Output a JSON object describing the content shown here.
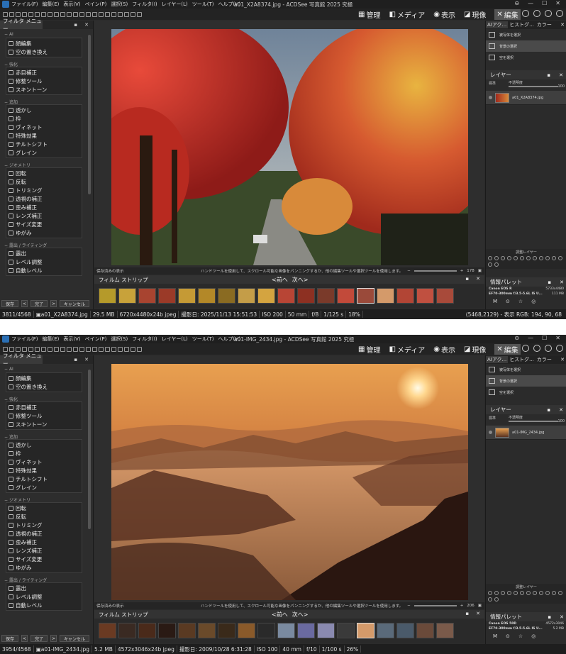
{
  "windows": [
    {
      "title": "a01_X2A8374.jpg - ACDSee 写真館 2025 究極",
      "menu": [
        "ファイル(F)",
        "編集(E)",
        "表示(V)",
        "ペイン(P)",
        "選択(S)",
        "フィルタ(I)",
        "レイヤー(L)",
        "ツール(T)",
        "ヘルプ(H)"
      ],
      "modes": [
        "管理",
        "メディア",
        "表示",
        "現像",
        "編集"
      ],
      "left_panel": {
        "tab": "フィルタ メニュー",
        "groups": [
          {
            "head": "AI",
            "items": [
              "顔編集",
              "空の置き換え"
            ]
          },
          {
            "head": "強化",
            "items": [
              "赤目補正",
              "修整ツール",
              "スキントーン"
            ]
          },
          {
            "head": "追加",
            "items": [
              "透かし",
              "枠",
              "ヴィネット",
              "特殊効果",
              "チルトシフト",
              "グレイン"
            ]
          },
          {
            "head": "ジオメトリ",
            "items": [
              "回転",
              "反転",
              "トリミング",
              "透視の補正",
              "歪み補正",
              "レンズ補正",
              "サイズ変更",
              "ゆがみ"
            ]
          },
          {
            "head": "露出 / ライティング",
            "items": [
              "露出",
              "レベル調整",
              "自動レベル"
            ]
          }
        ],
        "buttons": {
          "save": "保存",
          "done": "完了",
          "cancel": "キャンセル"
        }
      },
      "viewer_status": {
        "left": "保存済みの表示",
        "hint": "ハンドツールを使用して、スクロール可能な画像をパンニングするか、他の編集ツールや選択ツールを使用します。",
        "zoom": "178"
      },
      "filmstrip": {
        "title": "フィルム ストリップ",
        "prev": "<前へ",
        "next": "次へ>"
      },
      "right_panel": {
        "tabs": [
          "AIアク...",
          "ヒストグ...",
          "カラー"
        ],
        "ai_items": [
          "被写体を選択",
          "背景の選択",
          "空を選択"
        ],
        "layers_title": "レイヤー",
        "blend": "標準",
        "opacity_label": "不透明度",
        "opacity_value": "100",
        "layer_name": "a01_X2A8374.jpg",
        "adjust_title": "調整レイヤー",
        "info_title": "情報パレット",
        "camera": "Canon EOS R",
        "camera_val": "5733x4480",
        "lens": "EF70-300mm f/3.5-5.6L IS U...",
        "lens_val": "111 MB",
        "info_icons": [
          "M",
          "⊙",
          "☆",
          "◎"
        ]
      },
      "statusbar": [
        "3811/4568",
        "a01_X2A8374.jpg",
        "29.5 MB",
        "6720x4480x24b jpeg",
        "撮影日: 2025/11/13 15:51:53",
        "ISO 200",
        "50 mm",
        "f/8",
        "1/125 s",
        "18%"
      ],
      "statusbar_right": "(5468,2129) - 表示 RGB: 194, 90, 68",
      "thumb_colors": [
        "#b59a2a",
        "#c8a23a",
        "#a84430",
        "#9b3a28",
        "#c59a35",
        "#b38828",
        "#8a6b22",
        "#c49d48",
        "#d4a440",
        "#b84535",
        "#8d3022",
        "#7a3a2a",
        "#c24a3a",
        "#9a4a3a",
        "#d49a6a",
        "#b24535",
        "#c05040",
        "#a84a3a"
      ]
    },
    {
      "title": "a01-IMG_2434.jpg - ACDSee 写真館 2025 究極",
      "menu": [
        "ファイル(F)",
        "編集(E)",
        "表示(V)",
        "ペイン(P)",
        "選択(S)",
        "フィルタ(I)",
        "レイヤー(L)",
        "ツール(T)",
        "ヘルプ(H)"
      ],
      "modes": [
        "管理",
        "メディア",
        "表示",
        "現像",
        "編集"
      ],
      "left_panel": {
        "tab": "フィルタ メニュー",
        "groups": [
          {
            "head": "AI",
            "items": [
              "顔編集",
              "空の置き換え"
            ]
          },
          {
            "head": "強化",
            "items": [
              "赤目補正",
              "修整ツール",
              "スキントーン"
            ]
          },
          {
            "head": "追加",
            "items": [
              "透かし",
              "枠",
              "ヴィネット",
              "特殊効果",
              "チルトシフト",
              "グレイン"
            ]
          },
          {
            "head": "ジオメトリ",
            "items": [
              "回転",
              "反転",
              "トリミング",
              "透視の補正",
              "歪み補正",
              "レンズ補正",
              "サイズ変更",
              "ゆがみ"
            ]
          },
          {
            "head": "露出 / ライティング",
            "items": [
              "露出",
              "レベル調整",
              "自動レベル"
            ]
          }
        ],
        "buttons": {
          "save": "保存",
          "done": "完了",
          "cancel": "キャンセル"
        }
      },
      "viewer_status": {
        "left": "保存済みの表示",
        "hint": "ハンドツールを使用して、スクロール可能な画像をパンニングするか、他の編集ツールや選択ツールを使用します。",
        "zoom": "206"
      },
      "filmstrip": {
        "title": "フィルム ストリップ",
        "prev": "<前へ",
        "next": "次へ>"
      },
      "right_panel": {
        "tabs": [
          "AIアク...",
          "ヒストグ...",
          "カラー"
        ],
        "ai_items": [
          "被写体を選択",
          "背景の選択",
          "空を選択"
        ],
        "layers_title": "レイヤー",
        "blend": "標準",
        "opacity_label": "不透明度",
        "opacity_value": "100",
        "layer_name": "a01-IMG_2434.jpg",
        "adjust_title": "調整レイヤー",
        "info_title": "情報パレット",
        "camera": "Canon EOS 50D",
        "camera_val": "4572x3046",
        "lens": "EF70-300mm f/3.5-5.6L IS U...",
        "lens_val": "5.2 MB",
        "info_icons": [
          "M",
          "⊙",
          "☆",
          "◎"
        ]
      },
      "statusbar": [
        "3954/4568",
        "a01-IMG_2434.jpg",
        "5.2 MB",
        "4572x3046x24b jpeg",
        "撮影日: 2009/10/28 6:31:28",
        "ISO 100",
        "40 mm",
        "f/10",
        "1/100 s",
        "26%"
      ],
      "statusbar_right": "",
      "thumb_colors": [
        "#6a3a22",
        "#3a2a22",
        "#4a2a1a",
        "#2a1a14",
        "#5a3a22",
        "#6a4a2a",
        "#3a2a1a",
        "#8a5a2a",
        "#2a2a2a",
        "#7a8aa0",
        "#6a6aa0",
        "#8a8ab0",
        "#3a3a3a",
        "#d49a6a",
        "#5a6a7a",
        "#4a5a6a",
        "#6a4a3a",
        "#7a5a4a"
      ]
    }
  ]
}
